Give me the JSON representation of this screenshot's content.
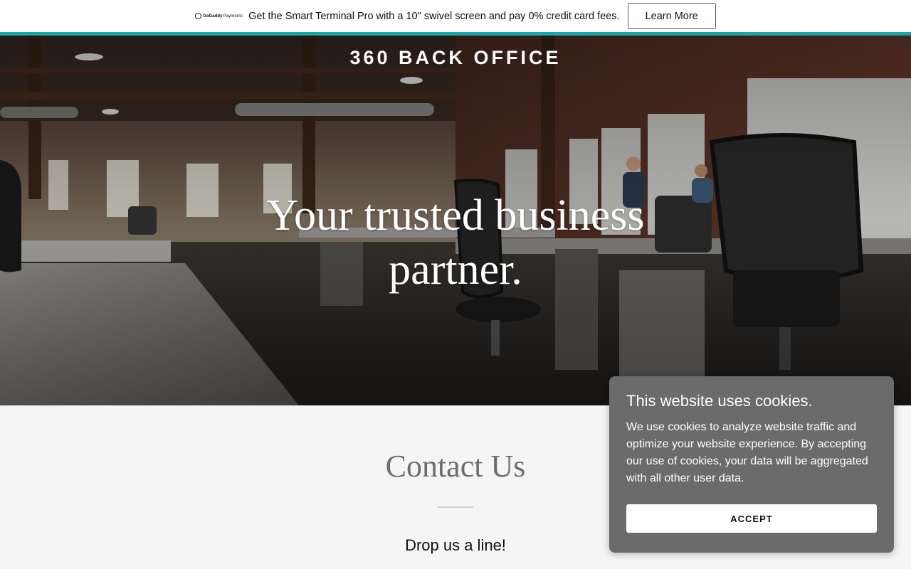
{
  "promo": {
    "logo_bold": "GoDaddy",
    "logo_light": "Payments",
    "text": "Get the Smart Terminal Pro with a 10\" swivel screen and pay 0% credit card fees.",
    "button_label": "Learn More"
  },
  "hero": {
    "brand": "360 BACK OFFICE",
    "tagline_line1": "Your trusted business",
    "tagline_line2": "partner."
  },
  "contact": {
    "title": "Contact Us",
    "subtitle": "Drop us a line!"
  },
  "cookie": {
    "title": "This website uses cookies.",
    "body": "We use cookies to analyze website traffic and optimize your website experience. By accepting our use of cookies, your data will be aggregated with all other user data.",
    "accept_label": "ACCEPT"
  },
  "colors": {
    "accent_line": "#1ba6a6",
    "cookie_bg": "#6b6b6b",
    "section_bg": "#f5f5f5"
  }
}
